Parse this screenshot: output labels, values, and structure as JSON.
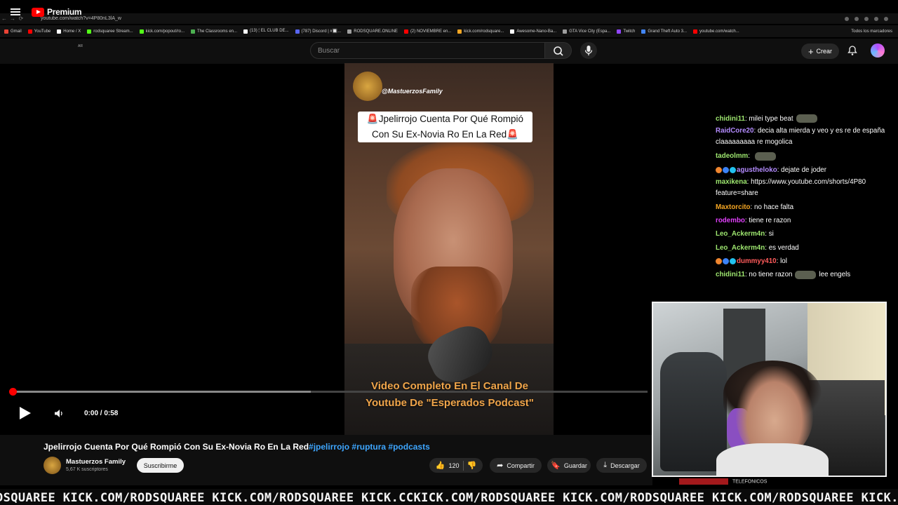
{
  "browser": {
    "url": "youtube.com/watch?v=4P80nL3lA_w",
    "bookmarks": [
      {
        "label": "Gmail",
        "color": "#ea4335"
      },
      {
        "label": "YouTube",
        "color": "#ff0000"
      },
      {
        "label": "Home / X",
        "color": "#ffffff"
      },
      {
        "label": "rodsquaree Stream...",
        "color": "#53fc18"
      },
      {
        "label": "kick.com/popout/ro...",
        "color": "#53fc18"
      },
      {
        "label": "The Classrooms en...",
        "color": "#4caf50"
      },
      {
        "label": "(13) 🕯 EL CLUB DE...",
        "color": "#ffffff"
      },
      {
        "label": "(787) Discord | #🔲...",
        "color": "#5865f2"
      },
      {
        "label": "RODSQUARE.ONLINE",
        "color": "#9e9e9e"
      },
      {
        "label": "(2) NOVIEMBRE en...",
        "color": "#ff0000"
      },
      {
        "label": "kick.com/rodsquare...",
        "color": "#f5a623"
      },
      {
        "label": "Awesome-Nano-Ba...",
        "color": "#ffffff"
      },
      {
        "label": "GTA Vice City (Espa...",
        "color": "#9e9e9e"
      },
      {
        "label": "Twitch",
        "color": "#9146ff"
      },
      {
        "label": "Grand Theft Auto 3...",
        "color": "#4285f4"
      },
      {
        "label": "youtube.com/watch...",
        "color": "#ff0000"
      }
    ],
    "all_bookmarks": "Todos los marcadores"
  },
  "youtube": {
    "logo_text": "Premium",
    "logo_sup": "AR",
    "search_placeholder": "Buscar",
    "create_label": "Crear"
  },
  "video": {
    "channel_handle": "@MastuerzosFamily",
    "overlay_title_line1": "🚨Jpelirrojo Cuenta Por Qué Rompió",
    "overlay_title_line2": "Con Su Ex-Novia Ro En La Red🚨",
    "caption_line1": "Video Completo En El Canal De",
    "caption_line2": "Youtube De \"Esperados Podcast\"",
    "time": "0:00 / 0:58",
    "progress_fraction": 0.0,
    "buffered_fraction": 0.47,
    "title_main": "Jpelirrojo Cuenta Por Qué Rompió Con Su Ex-Novia Ro En La Red",
    "title_tags": "#jpelirrojo #ruptura #podcasts",
    "channel_name": "Mastuerzos Family",
    "subscribers": "5,67 K suscriptores",
    "subscribe_label": "Suscribirme",
    "likes": "120",
    "share_label": "Compartir",
    "save_label": "Guardar",
    "download_label": "Descargar"
  },
  "chat": [
    {
      "user": "chidini11",
      "color": "#9fe870",
      "text": "milei type beat",
      "emote_after": true
    },
    {
      "user": "RaidCore20",
      "color": "#b48cff",
      "text": "decia alta mierda y veo y es re de españa claaaaaaaaa re mogolica",
      "wrap": true
    },
    {
      "user": "tadeolmm",
      "color": "#9fe870",
      "text": "",
      "emote_after": true
    },
    {
      "user": "agustheloko",
      "color": "#b48cff",
      "text": "dejate de joder",
      "badges": true
    },
    {
      "user": "maxikena",
      "color": "#9fe870",
      "text": "https://www.youtube.com/shorts/4P80 feature=share",
      "wrap": true
    },
    {
      "user": "Maxtorcito",
      "color": "#f5a623",
      "text": "no hace falta"
    },
    {
      "user": "rodembo",
      "color": "#e040fb",
      "text": "tiene re razon"
    },
    {
      "user": "Leo_Ackerm4n",
      "color": "#9fe870",
      "text": "si"
    },
    {
      "user": "Leo_Ackerm4n",
      "color": "#9fe870",
      "text": "es verdad"
    },
    {
      "user": "dummyy410",
      "color": "#ff5b5b",
      "text": "lol",
      "badges": true
    },
    {
      "user": "chidini11",
      "color": "#9fe870",
      "text": "no tiene razon",
      "emote_mid": true,
      "text_after": "lee engels"
    }
  ],
  "below_cam_text": "TELEFONICOS",
  "ticker": "DSQUAREE KICK.COM/RODSQUAREE KICK.COM/RODSQUAREE KICK.CCKICK.COM/RODSQUAREE KICK.COM/RODSQUAREE KICK.COM/RODSQUAREE KICK.COM/RO",
  "colors": {
    "accent": "#ff0000",
    "link": "#3ea6ff"
  }
}
